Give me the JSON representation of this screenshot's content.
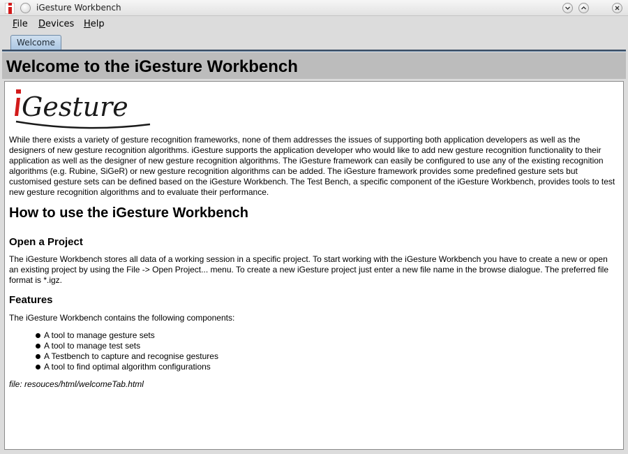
{
  "window": {
    "title": "iGesture Workbench"
  },
  "menu": {
    "items": [
      {
        "label": "File",
        "mnemonic": "F",
        "rest": "ile"
      },
      {
        "label": "Devices",
        "mnemonic": "D",
        "rest": "evices"
      },
      {
        "label": "Help",
        "mnemonic": "H",
        "rest": "elp"
      }
    ]
  },
  "tabs": [
    {
      "label": "Welcome",
      "selected": true
    }
  ],
  "banner": {
    "heading": "Welcome to the iGesture Workbench"
  },
  "logo": {
    "text": "iGesture",
    "accent_color": "#d21a1a"
  },
  "content": {
    "intro": "While there exists a variety of gesture recognition frameworks, none of them addresses the issues of supporting both application developers as well as the designers of new gesture recognition algorithms. iGesture supports the application developer who would like to add new gesture recognition functionality to their application as well as the designer of new gesture recognition algorithms. The iGesture framework can easily be configured to use any of the existing recognition algorithms (e.g. Rubine, SiGeR) or new gesture recognition algorithms can be added. The iGesture framework provides some predefined gesture sets but customised gesture sets can be defined based on the iGesture Workbench. The Test Bench, a specific component of the iGesture Workbench, provides tools to test new gesture recognition algorithms and to evaluate their performance.",
    "how_to_heading": "How to use the iGesture Workbench",
    "open_project_heading": "Open a Project",
    "open_project_text": "The iGesture Workbench stores all data of a working session in a specific project. To start working with the iGesture Workbench you have to create a new or open an existing project by using the File -> Open Project... menu. To create a new iGesture project just enter a new file name in the browse dialogue. The preferred file format is *.igz.",
    "features_heading": "Features",
    "features_intro": "The iGesture Workbench contains the following components:",
    "features": [
      "A tool to manage gesture sets",
      "A tool to manage test sets",
      "A Testbench to capture and recognise gestures",
      "A tool to find optimal algorithm configurations"
    ],
    "file_note": "file: resouces/html/welcomeTab.html"
  }
}
